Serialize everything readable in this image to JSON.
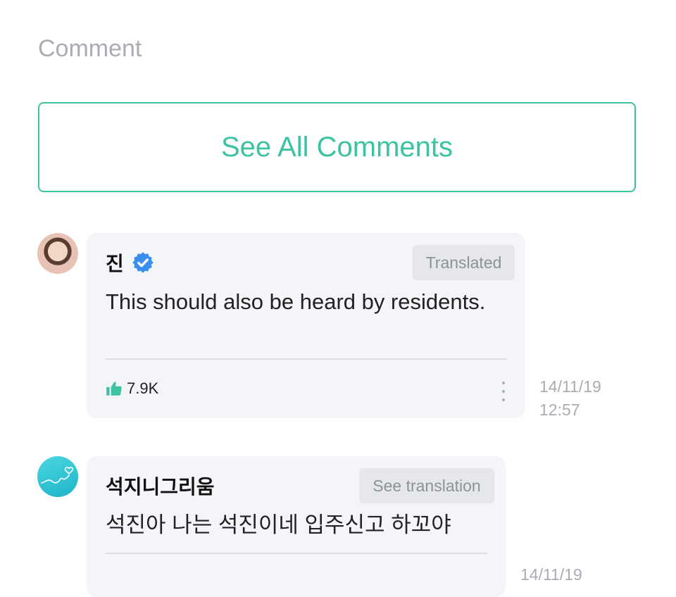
{
  "section": {
    "title": "Comment"
  },
  "see_all": {
    "label": "See All Comments"
  },
  "comments": [
    {
      "author": "진",
      "verified": true,
      "tag": "Translated",
      "text": "This should also be heard by residents.",
      "likes": "7.9K",
      "date": "14/11/19",
      "time": "12:57"
    },
    {
      "author": "석지니그리움",
      "verified": false,
      "tag": "See translation",
      "text": "석진아 나는 석진이네 입주신고 하꼬야",
      "date": "14/11/19"
    }
  ],
  "colors": {
    "accent": "#3dc3a2",
    "verified": "#3a8ef0",
    "muted": "#a9adb3"
  }
}
